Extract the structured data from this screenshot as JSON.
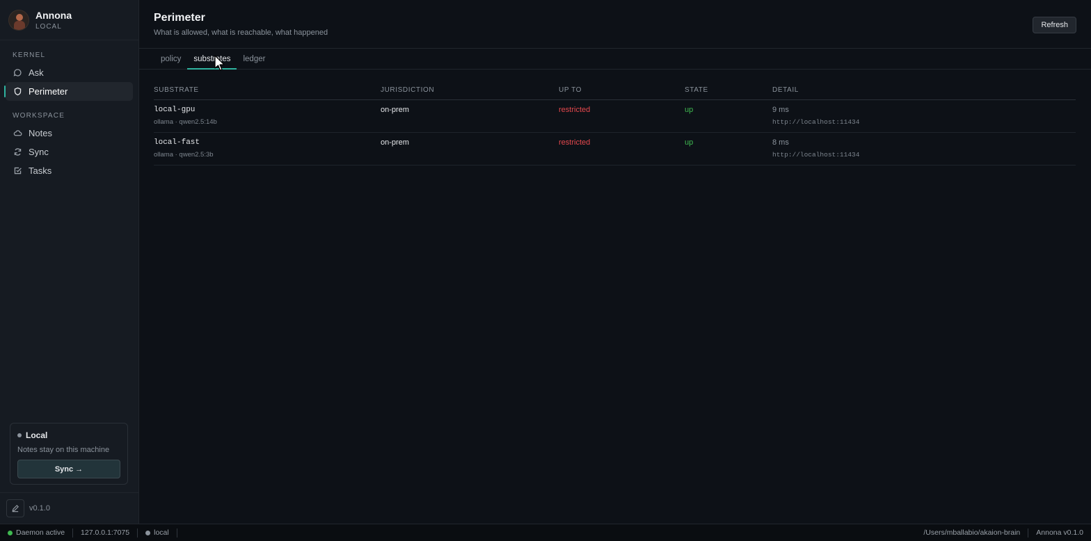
{
  "app": {
    "name": "Annona",
    "mode": "LOCAL"
  },
  "sidebar": {
    "kernel_label": "KERNEL",
    "workspace_label": "WORKSPACE",
    "kernel_items": [
      {
        "label": "Ask",
        "icon": "chat-icon"
      },
      {
        "label": "Perimeter",
        "icon": "shield-icon"
      }
    ],
    "workspace_items": [
      {
        "label": "Notes",
        "icon": "cloud-icon"
      },
      {
        "label": "Sync",
        "icon": "refresh-icon"
      },
      {
        "label": "Tasks",
        "icon": "checkbox-icon"
      }
    ],
    "local_card": {
      "title": "Local",
      "description": "Notes stay on this machine",
      "button": "Sync →"
    },
    "version": "v0.1.0"
  },
  "header": {
    "title": "Perimeter",
    "subtitle": "What is allowed, what is reachable, what happened",
    "refresh": "Refresh"
  },
  "tabs": [
    {
      "label": "policy",
      "active": false
    },
    {
      "label": "substrates",
      "active": true
    },
    {
      "label": "ledger",
      "active": false
    }
  ],
  "table": {
    "columns": [
      "SUBSTRATE",
      "JURISDICTION",
      "UP TO",
      "STATE",
      "DETAIL"
    ],
    "rows": [
      {
        "name": "local-gpu",
        "model": "ollama · qwen2.5:14b",
        "jurisdiction": "on-prem",
        "up_to": "restricted",
        "state": "up",
        "latency": "9 ms",
        "url": "http://localhost:11434"
      },
      {
        "name": "local-fast",
        "model": "ollama · qwen2.5:3b",
        "jurisdiction": "on-prem",
        "up_to": "restricted",
        "state": "up",
        "latency": "8 ms",
        "url": "http://localhost:11434"
      }
    ]
  },
  "statusbar": {
    "daemon": "Daemon active",
    "address": "127.0.0.1:7075",
    "scope": "local",
    "path": "/Users/mballabio/akaion-brain",
    "app_version": "Annona v0.1.0"
  },
  "colors": {
    "accent": "#2fb4a0",
    "danger": "#e5484d",
    "ok": "#3fb950"
  }
}
